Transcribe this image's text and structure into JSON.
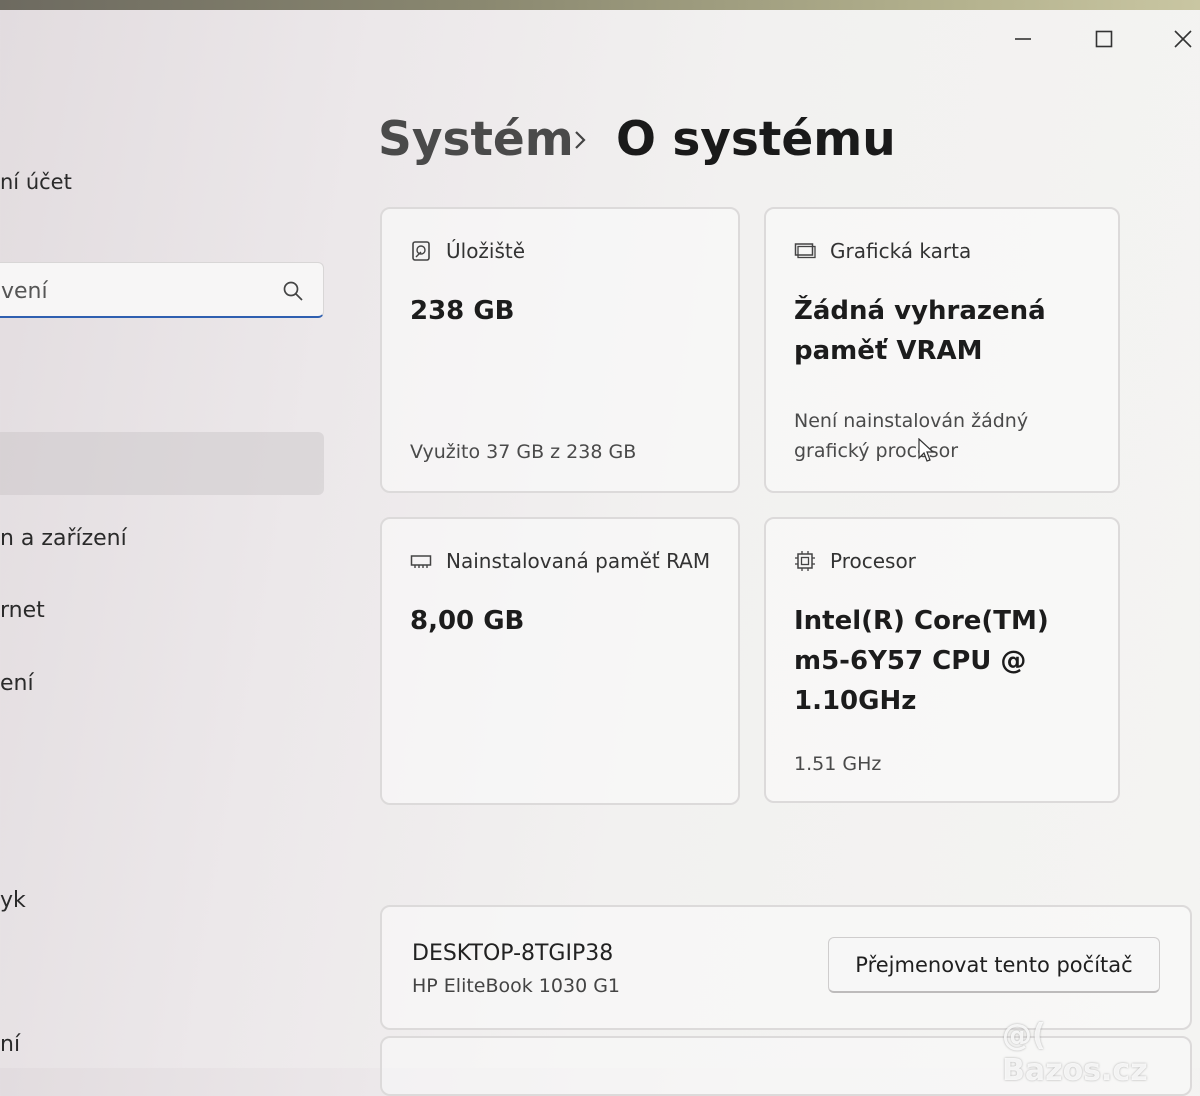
{
  "window_controls": {
    "minimize": "minimize-icon",
    "maximize": "maximize-icon",
    "close": "close-icon"
  },
  "sidebar": {
    "account_fragment": "ní účet",
    "search_fragment": "vení",
    "items": [
      {
        "label": "n a zařízení"
      },
      {
        "label": "rnet"
      },
      {
        "label": "ení"
      },
      {
        "label": "yk"
      },
      {
        "label": "ní"
      }
    ]
  },
  "breadcrumb": {
    "parent": "Systém",
    "current": "O systému"
  },
  "cards": {
    "storage": {
      "title": "Úložiště",
      "value": "238 GB",
      "sub": "Využito 37 GB z 238 GB"
    },
    "gpu": {
      "title": "Grafická karta",
      "value": "Žádná vyhrazená paměť VRAM",
      "sub": "Není nainstalován žádný grafický procesor"
    },
    "ram": {
      "title": "Nainstalovaná paměť RAM",
      "value": "8,00 GB"
    },
    "cpu": {
      "title": "Procesor",
      "value": "Intel(R) Core(TM) m5-6Y57 CPU @ 1.10GHz",
      "sub": "1.51 GHz"
    }
  },
  "device": {
    "name": "DESKTOP-8TGIP38",
    "model": "HP EliteBook 1030 G1",
    "rename_label": "Přejmenovat tento počítač"
  },
  "watermark": "@( Bazos.cz"
}
